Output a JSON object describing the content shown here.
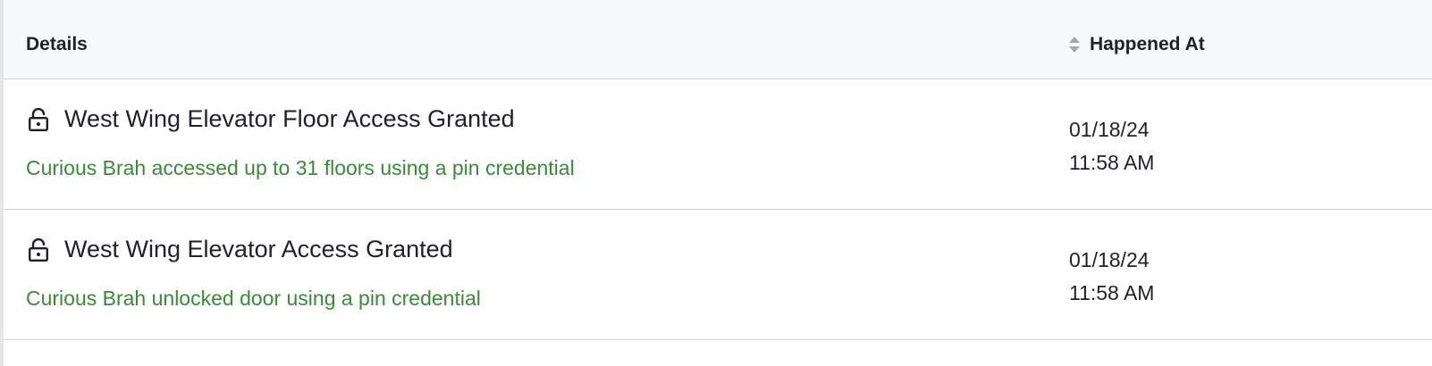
{
  "table": {
    "columns": {
      "details": "Details",
      "happened_at": "Happened At"
    },
    "rows": [
      {
        "icon": "unlocked-icon",
        "title": "West Wing Elevator Floor Access Granted",
        "description": "Curious Brah accessed up to 31 floors using a pin credential",
        "date": "01/18/24",
        "time": "11:58 AM"
      },
      {
        "icon": "unlocked-icon",
        "title": "West Wing Elevator Access Granted",
        "description": "Curious Brah unlocked door using a pin credential",
        "date": "01/18/24",
        "time": "11:58 AM"
      }
    ]
  },
  "colors": {
    "description_green": "#3a8a3a",
    "header_bg": "#f8f9fc",
    "text_dark": "#1f2128",
    "divider": "#cfd2d8"
  }
}
